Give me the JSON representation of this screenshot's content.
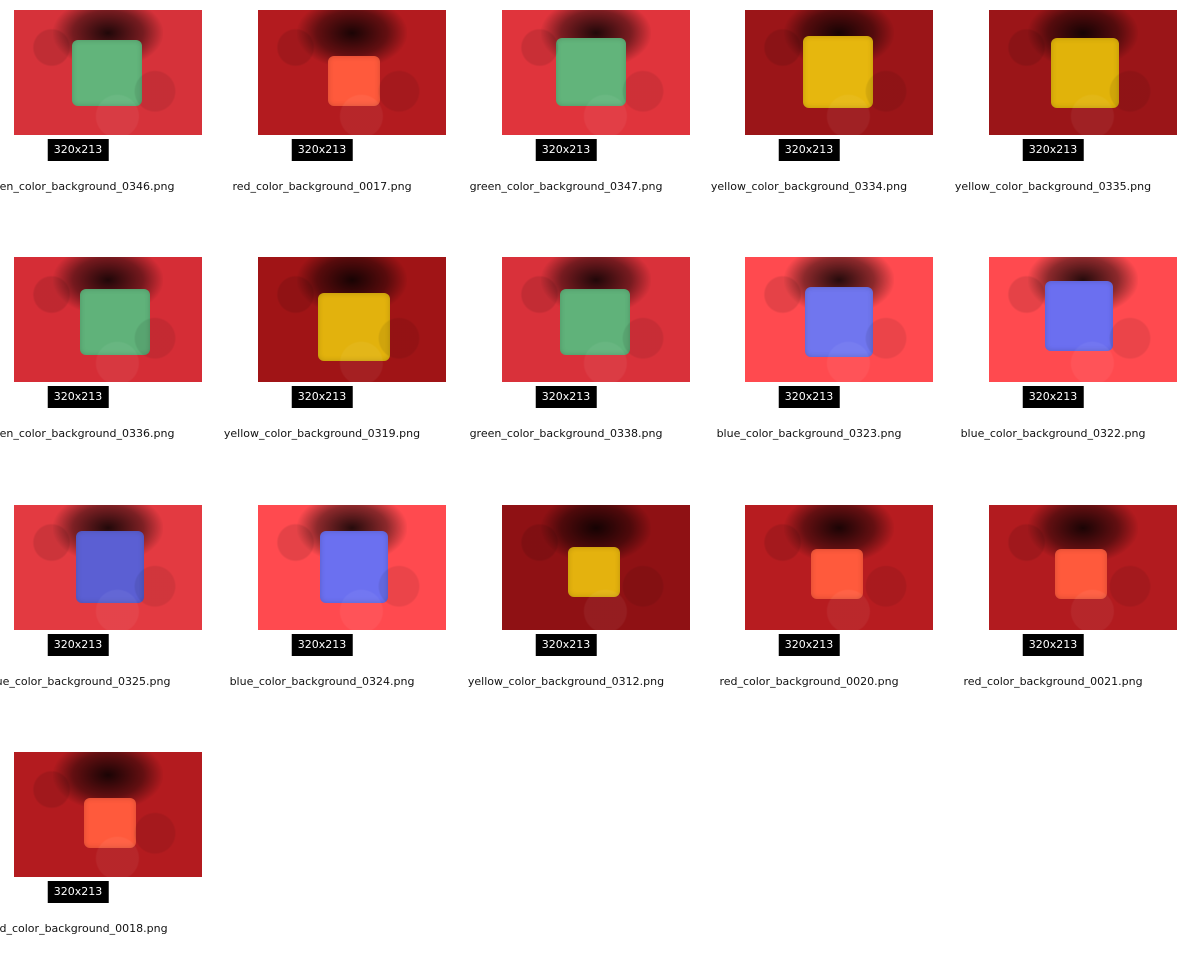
{
  "tiles": [
    {
      "dim": "320x213",
      "filename": "green_color_background_0346.png",
      "bg": "#d6323a",
      "block": "#62b47b"
    },
    {
      "dim": "320x213",
      "filename": "red_color_background_0017.png",
      "bg": "#b31b1f",
      "block": "#ff5a3c"
    },
    {
      "dim": "320x213",
      "filename": "green_color_background_0347.png",
      "bg": "#e0343c",
      "block": "#62b47b"
    },
    {
      "dim": "320x213",
      "filename": "yellow_color_background_0334.png",
      "bg": "#9b1518",
      "block": "#e6b70e"
    },
    {
      "dim": "320x213",
      "filename": "yellow_color_background_0335.png",
      "bg": "#9b1518",
      "block": "#e1b30a"
    },
    {
      "dim": "320x213",
      "filename": "green_color_background_0336.png",
      "bg": "#d52d36",
      "block": "#60b27a"
    },
    {
      "dim": "320x213",
      "filename": "yellow_color_background_0319.png",
      "bg": "#a01416",
      "block": "#e2b20d"
    },
    {
      "dim": "320x213",
      "filename": "green_color_background_0338.png",
      "bg": "#d9313a",
      "block": "#60b27a"
    },
    {
      "dim": "320x213",
      "filename": "blue_color_background_0323.png",
      "bg": "#ff4a4f",
      "block": "#7076ef"
    },
    {
      "dim": "320x213",
      "filename": "blue_color_background_0322.png",
      "bg": "#ff4a4f",
      "block": "#6b6ff0"
    },
    {
      "dim": "320x213",
      "filename": "blue_color_background_0325.png",
      "bg": "#e33a41",
      "block": "#5b5fd3"
    },
    {
      "dim": "320x213",
      "filename": "blue_color_background_0324.png",
      "bg": "#ff4a4f",
      "block": "#6b70f0"
    },
    {
      "dim": "320x213",
      "filename": "yellow_color_background_0312.png",
      "bg": "#8f1114",
      "block": "#e4b20e"
    },
    {
      "dim": "320x213",
      "filename": "red_color_background_0020.png",
      "bg": "#b71c20",
      "block": "#ff5a3c"
    },
    {
      "dim": "320x213",
      "filename": "red_color_background_0021.png",
      "bg": "#b21b1f",
      "block": "#ff5a3c"
    },
    {
      "dim": "320x213",
      "filename": "red_color_background_0018.png",
      "bg": "#b31b1f",
      "block": "#ff5a3c"
    }
  ]
}
